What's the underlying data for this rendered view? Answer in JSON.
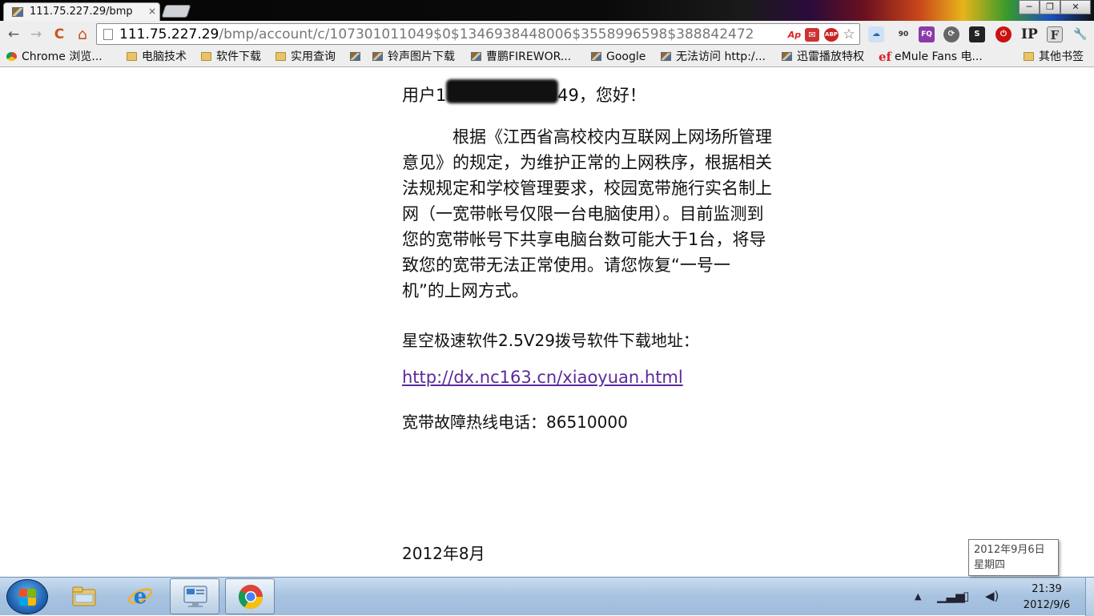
{
  "browser": {
    "tab": {
      "title": "111.75.227.29/bmp",
      "close": "×"
    },
    "window_controls": {
      "minimize": "─",
      "restore": "❐",
      "close": "✕"
    },
    "nav": {
      "back": "←",
      "forward": "→",
      "reload": "C",
      "home": "⌂"
    },
    "address": {
      "host": "111.75.227.29",
      "path": "/bmp/account/c/107301011049$0$1346938448006$3558996598$388842472"
    },
    "omnibox_icons": [
      "Ap",
      "✉",
      "ABP",
      "☆"
    ],
    "extensions": [
      "☁",
      "90",
      "FQ",
      "⟳",
      "S",
      "⏻",
      "IP",
      "F",
      "🔧"
    ],
    "bookmarks": [
      {
        "label": "Chrome 浏览...",
        "icon": "chrome"
      },
      {
        "label": "电脑技术",
        "icon": "folder"
      },
      {
        "label": "软件下载",
        "icon": "folder"
      },
      {
        "label": "实用查询",
        "icon": "folder"
      },
      {
        "label": "",
        "icon": "page"
      },
      {
        "label": "铃声图片下载",
        "icon": "page"
      },
      {
        "label": "曹鹏FIREWOR...",
        "icon": "page"
      },
      {
        "label": "Google",
        "icon": "page"
      },
      {
        "label": "无法访问 http:/...",
        "icon": "page"
      },
      {
        "label": "迅雷播放特权",
        "icon": "page"
      },
      {
        "label": "eMule Fans 电...",
        "icon": "ef"
      }
    ],
    "other_bookmarks": "其他书签"
  },
  "page": {
    "greeting_prefix": "用户1",
    "greeting_suffix": "1049，您好！",
    "notice_lines": [
      "　　　根据《江西省高校校内互联网上网场所管理",
      "意见》的规定，为维护正常的上网秩序，根据相关",
      "法规规定和学校管理要求，校园宽带施行实名制上",
      "网（一宽带帐号仅限一台电脑使用）。目前监测到",
      "您的宽带帐号下共享电脑台数可能大于1台，将导",
      "致您的宽带无法正常使用。请您恢复“一号一",
      "机”的上网方式。"
    ],
    "software_label": "星空极速软件2.5V29拨号软件下载地址：",
    "download_link": "http://dx.nc163.cn/xiaoyuan.html",
    "hotline": "宽带故障热线电话：86510000",
    "date": "2012年8月"
  },
  "tooltip": {
    "line1": "2012年9月6日",
    "line2": "星期四"
  },
  "taskbar": {
    "apps": [
      "windows-explorer",
      "internet-explorer",
      "remote-desktop",
      "google-chrome"
    ],
    "clock_time": "21:39",
    "clock_date": "2012/9/6"
  }
}
